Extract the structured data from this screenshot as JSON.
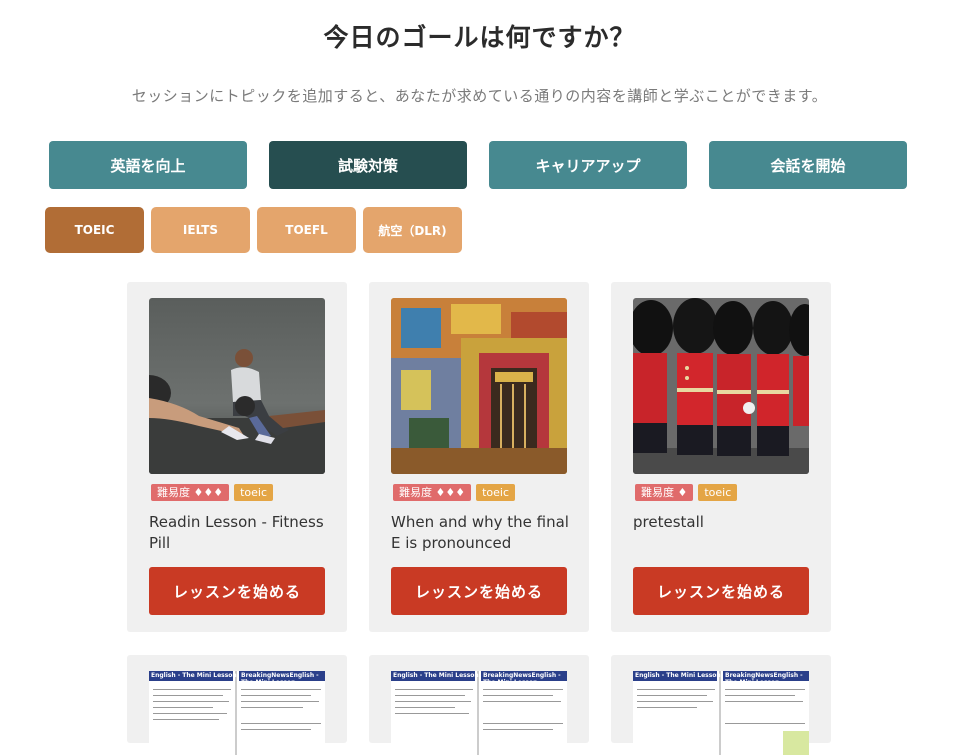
{
  "header": {
    "title": "今日のゴールは何ですか？",
    "subtitle": "セッションにトピックを追加すると、あなたが求めている通りの内容を講師と学ぶことができます。"
  },
  "goals": [
    {
      "label": "英語を向上",
      "active": false
    },
    {
      "label": "試験対策",
      "active": true
    },
    {
      "label": "キャリアアップ",
      "active": false
    },
    {
      "label": "会話を開始",
      "active": false
    }
  ],
  "subtopics": [
    {
      "label": "TOEIC",
      "active": true
    },
    {
      "label": "IELTS",
      "active": false
    },
    {
      "label": "TOEFL",
      "active": false
    },
    {
      "label": "航空（DLR)",
      "active": false
    }
  ],
  "lessons": [
    {
      "difficulty": "難易度 ♦♦♦",
      "topic": "toeic",
      "title": "Readin Lesson - Fitness Pill",
      "button": "レッスンを始める",
      "image": "fitness-photo"
    },
    {
      "difficulty": "難易度 ♦♦♦",
      "topic": "toeic",
      "title": "When and why the final E is pronounced",
      "button": "レッスンを始める",
      "image": "colorful-building-photo"
    },
    {
      "difficulty": "難易度 ♦",
      "topic": "toeic",
      "title": "pretestall",
      "button": "レッスンを始める",
      "image": "royal-guards-photo"
    }
  ],
  "more_lessons": [
    {
      "header_left": "English - The Mini Lesson",
      "header_right": "BreakingNewsEnglish - The Mini Lesson"
    },
    {
      "header_left": "English - The Mini Lesson",
      "header_right": "BreakingNewsEnglish - The Mini Lesson"
    },
    {
      "header_left": "English - The Mini Lesson",
      "header_right": "BreakingNewsEnglish - The Mini Lesson"
    }
  ],
  "colors": {
    "goal": "#478990",
    "goal_active": "#264e50",
    "chip": "#e4a56c",
    "chip_active": "#b16d36",
    "start_button": "#c93a24"
  }
}
